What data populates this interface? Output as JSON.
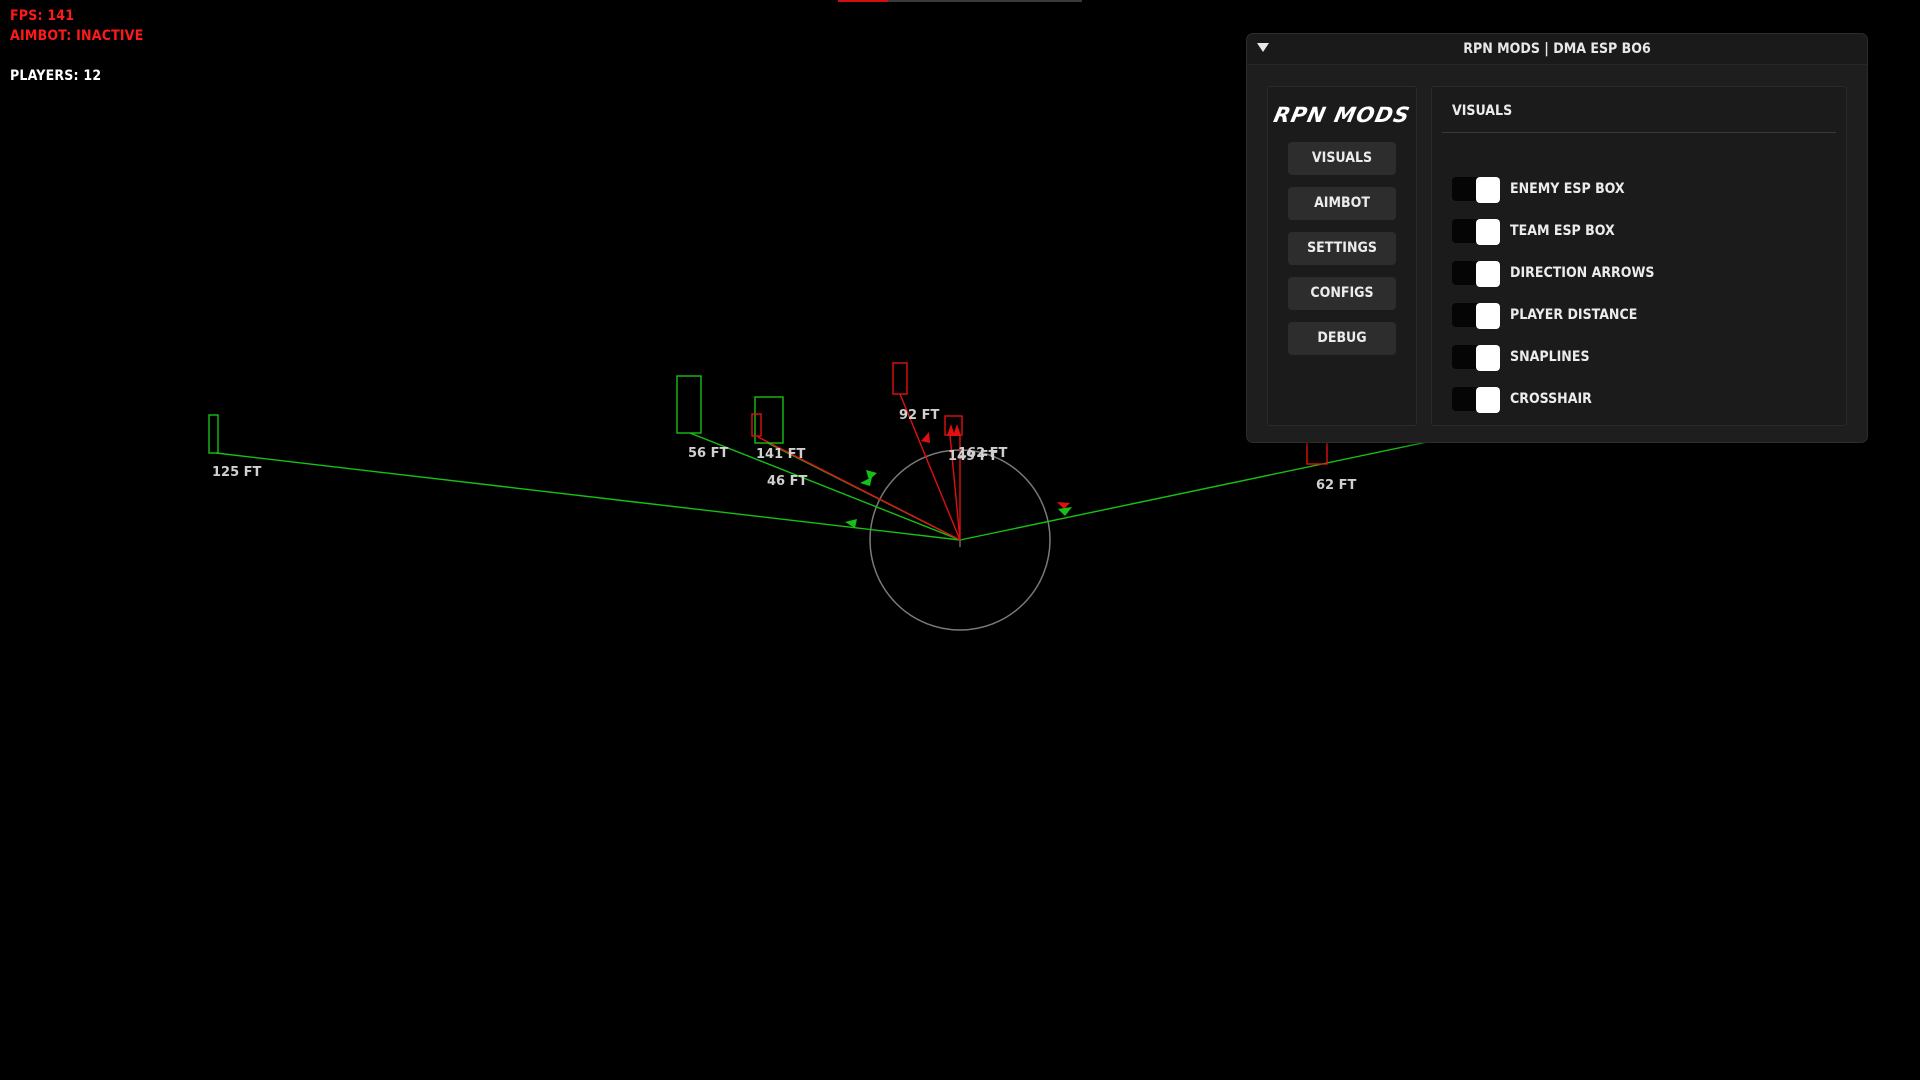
{
  "hud": {
    "fps": "FPS: 141",
    "aimbot": "AIMBOT: INACTIVE",
    "players": "PLAYERS: 12",
    "colors": {
      "warning": "#ff1a1a",
      "info": "#ffffff"
    }
  },
  "radar": {
    "colors": {
      "enemy": "#e01010",
      "team": "#16c016",
      "circle": "#7a7a7a"
    },
    "distance_labels": [
      "125 FT",
      "56 FT",
      "141 FT",
      "46 FT",
      "92 FT",
      "149 FT",
      "162 FT",
      "62 FT"
    ]
  },
  "menu": {
    "title": "RPN MODS | DMA ESP BO6",
    "collapse_icon": "triangle-down-icon",
    "brand": "RPN MODS",
    "nav": {
      "visuals": "VISUALS",
      "aimbot": "AIMBOT",
      "settings": "SETTINGS",
      "configs": "CONFIGS",
      "debug": "DEBUG"
    },
    "section_title": "VISUALS",
    "toggles": [
      {
        "label": "ENEMY ESP BOX",
        "checked": true
      },
      {
        "label": "TEAM ESP BOX",
        "checked": true
      },
      {
        "label": "DIRECTION ARROWS",
        "checked": true
      },
      {
        "label": "PLAYER DISTANCE",
        "checked": true
      },
      {
        "label": "SNAPLINES",
        "checked": true
      },
      {
        "label": "CROSSHAIR",
        "checked": true
      }
    ],
    "colors": {
      "window_bg": "#1e1e1e",
      "button_bg": "#2d2d2d",
      "toggle_knob": "#ffffff"
    }
  }
}
